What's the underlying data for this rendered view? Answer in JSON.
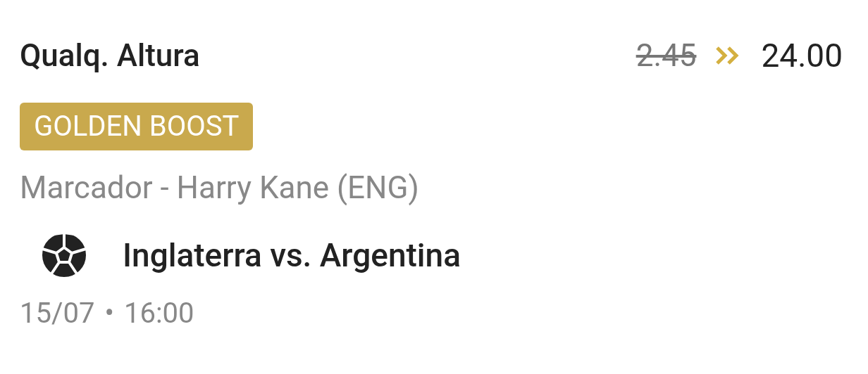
{
  "selection": {
    "title": "Qualq. Altura",
    "old_odds": "2.45",
    "new_odds": "24.00"
  },
  "badge": {
    "label": "GOLDEN BOOST"
  },
  "market": "Marcador - Harry Kane (ENG)",
  "event": {
    "name": "Inglaterra vs. Argentina"
  },
  "time": {
    "date": "15/07",
    "separator": "•",
    "clock": "16:00"
  }
}
